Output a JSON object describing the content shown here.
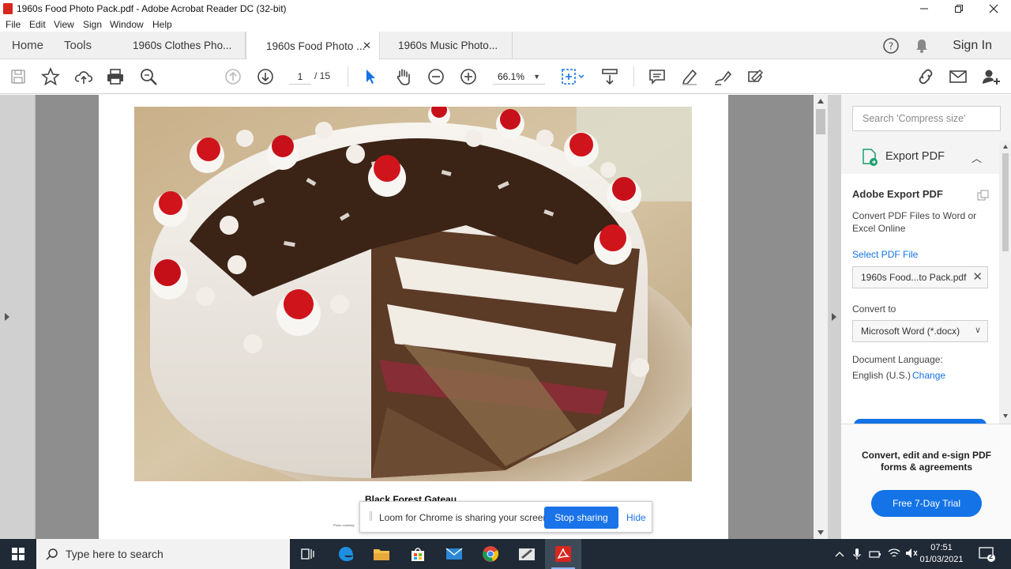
{
  "window": {
    "title": "1960s Food Photo Pack.pdf - Adobe Acrobat Reader DC (32-bit)"
  },
  "menu": [
    "File",
    "Edit",
    "View",
    "Sign",
    "Window",
    "Help"
  ],
  "nav_tabs": [
    "Home",
    "Tools"
  ],
  "doc_tabs": [
    {
      "label": "1960s Clothes Pho...",
      "active": false
    },
    {
      "label": "1960s Food Photo ...",
      "active": true
    },
    {
      "label": "1960s Music Photo...",
      "active": false
    }
  ],
  "header_right": {
    "sign_in": "Sign In"
  },
  "toolbar": {
    "page_current": "1",
    "page_total": "/ 15",
    "zoom": "66.1%"
  },
  "document": {
    "caption": "Black Forest Gateau",
    "credit": "Photo courtesy"
  },
  "right_panel": {
    "search_placeholder": "Search 'Compress size'",
    "export_label": "Export PDF",
    "title": "Adobe Export PDF",
    "description": "Convert PDF Files to Word or Excel Online",
    "select_file": "Select PDF File",
    "file_name": "1960s Food...to Pack.pdf",
    "convert_to_label": "Convert to",
    "convert_to_value": "Microsoft Word (*.docx)",
    "doc_language_label": "Document Language:",
    "doc_language_value": "English (U.S.)",
    "change_link": "Change",
    "footer_message": "Convert, edit and e-sign PDF forms & agreements",
    "trial_button": "Free 7-Day Trial"
  },
  "loom": {
    "message": "Loom for Chrome is sharing your screen.",
    "stop": "Stop sharing",
    "hide": "Hide"
  },
  "taskbar": {
    "search_placeholder": "Type here to search",
    "time": "07:51",
    "date": "01/03/2021",
    "notifications": "2"
  },
  "colors": {
    "accent_blue": "#1473e6",
    "pdf_red": "#d7261e",
    "taskbar": "#1f2a36"
  }
}
